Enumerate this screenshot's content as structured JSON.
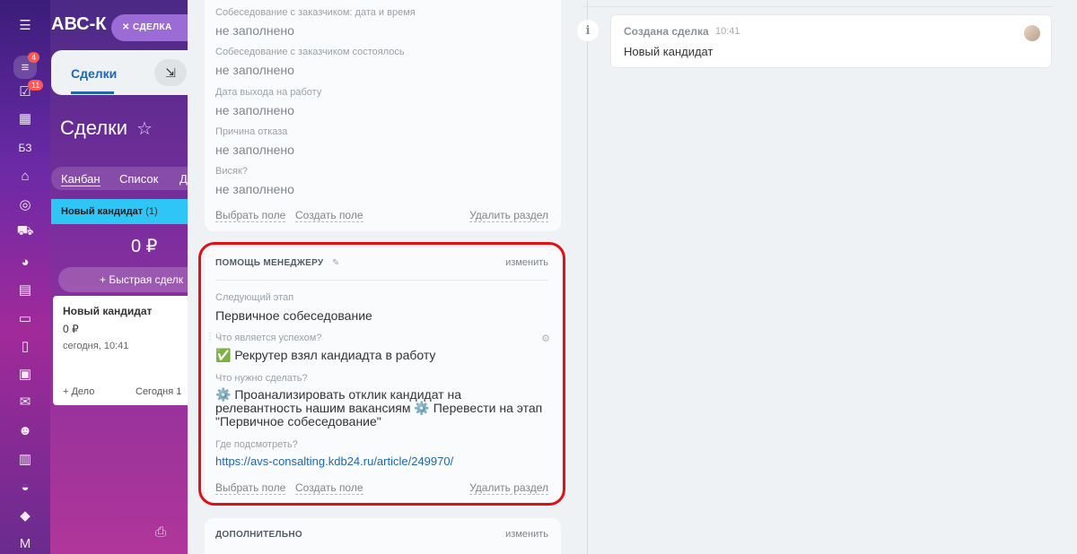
{
  "rail": {
    "badge_1": "4",
    "badge_2": "11",
    "kb_label": "БЗ"
  },
  "background": {
    "app_title": "АВС-К",
    "close_tab_label": "СДЕЛКА",
    "tab_deals": "Сделки",
    "page_title": "Сделки",
    "view_kanban": "Канбан",
    "view_list": "Список",
    "view_more": "Д",
    "column_title": "Новый кандидат",
    "column_count": "(1)",
    "column_sum": "0 ₽",
    "quick_deal": "Быстрая сделк",
    "card": {
      "name": "Новый кандидат",
      "price": "0 ₽",
      "date": "сегодня, 10:41",
      "add_action": "+ Дело",
      "today": "Сегодня 1"
    }
  },
  "block1": {
    "fields": [
      {
        "label": "Собеседование с заказчиком: дата и время",
        "value": "не заполнено"
      },
      {
        "label": "Собеседование с заказчиком состоялось",
        "value": "не заполнено"
      },
      {
        "label": "Дата выхода на работу",
        "value": "не заполнено"
      },
      {
        "label": "Причина отказа",
        "value": "не заполнено"
      },
      {
        "label": "Висяк?",
        "value": "не заполнено"
      }
    ],
    "select_field": "Выбрать поле",
    "create_field": "Создать поле",
    "delete_section": "Удалить раздел"
  },
  "block2": {
    "title": "ПОМОЩЬ МЕНЕДЖЕРУ",
    "edit": "изменить",
    "next_stage_label": "Следующий этап",
    "next_stage_value": "Первичное собеседование",
    "success_label": "Что является успехом?",
    "success_value": "✅ Рекрутер взял кандиадта в работу",
    "todo_label": "Что нужно сделать?",
    "todo_line1": "⚙️ Проанализировать отклик кандидат на",
    "todo_line2": "релевантность нашим вакансиям ⚙️ Перевести на этап",
    "todo_line3": "\"Первичное собеседование\"",
    "where_label": "Где подсмотреть?",
    "where_link": "https://avs-consalting.kdb24.ru/article/249970/",
    "select_field": "Выбрать поле",
    "create_field": "Создать поле",
    "delete_section": "Удалить раздел"
  },
  "block3": {
    "title": "ДОПОЛНИТЕЛЬНО",
    "edit": "изменить"
  },
  "timeline": {
    "event_title": "Создана сделка",
    "event_time": "10:41",
    "event_text": "Новый кандидат"
  },
  "colors": {
    "highlight": "#e01019",
    "link": "#2067b0",
    "column_accent": "#2fc6f6"
  }
}
